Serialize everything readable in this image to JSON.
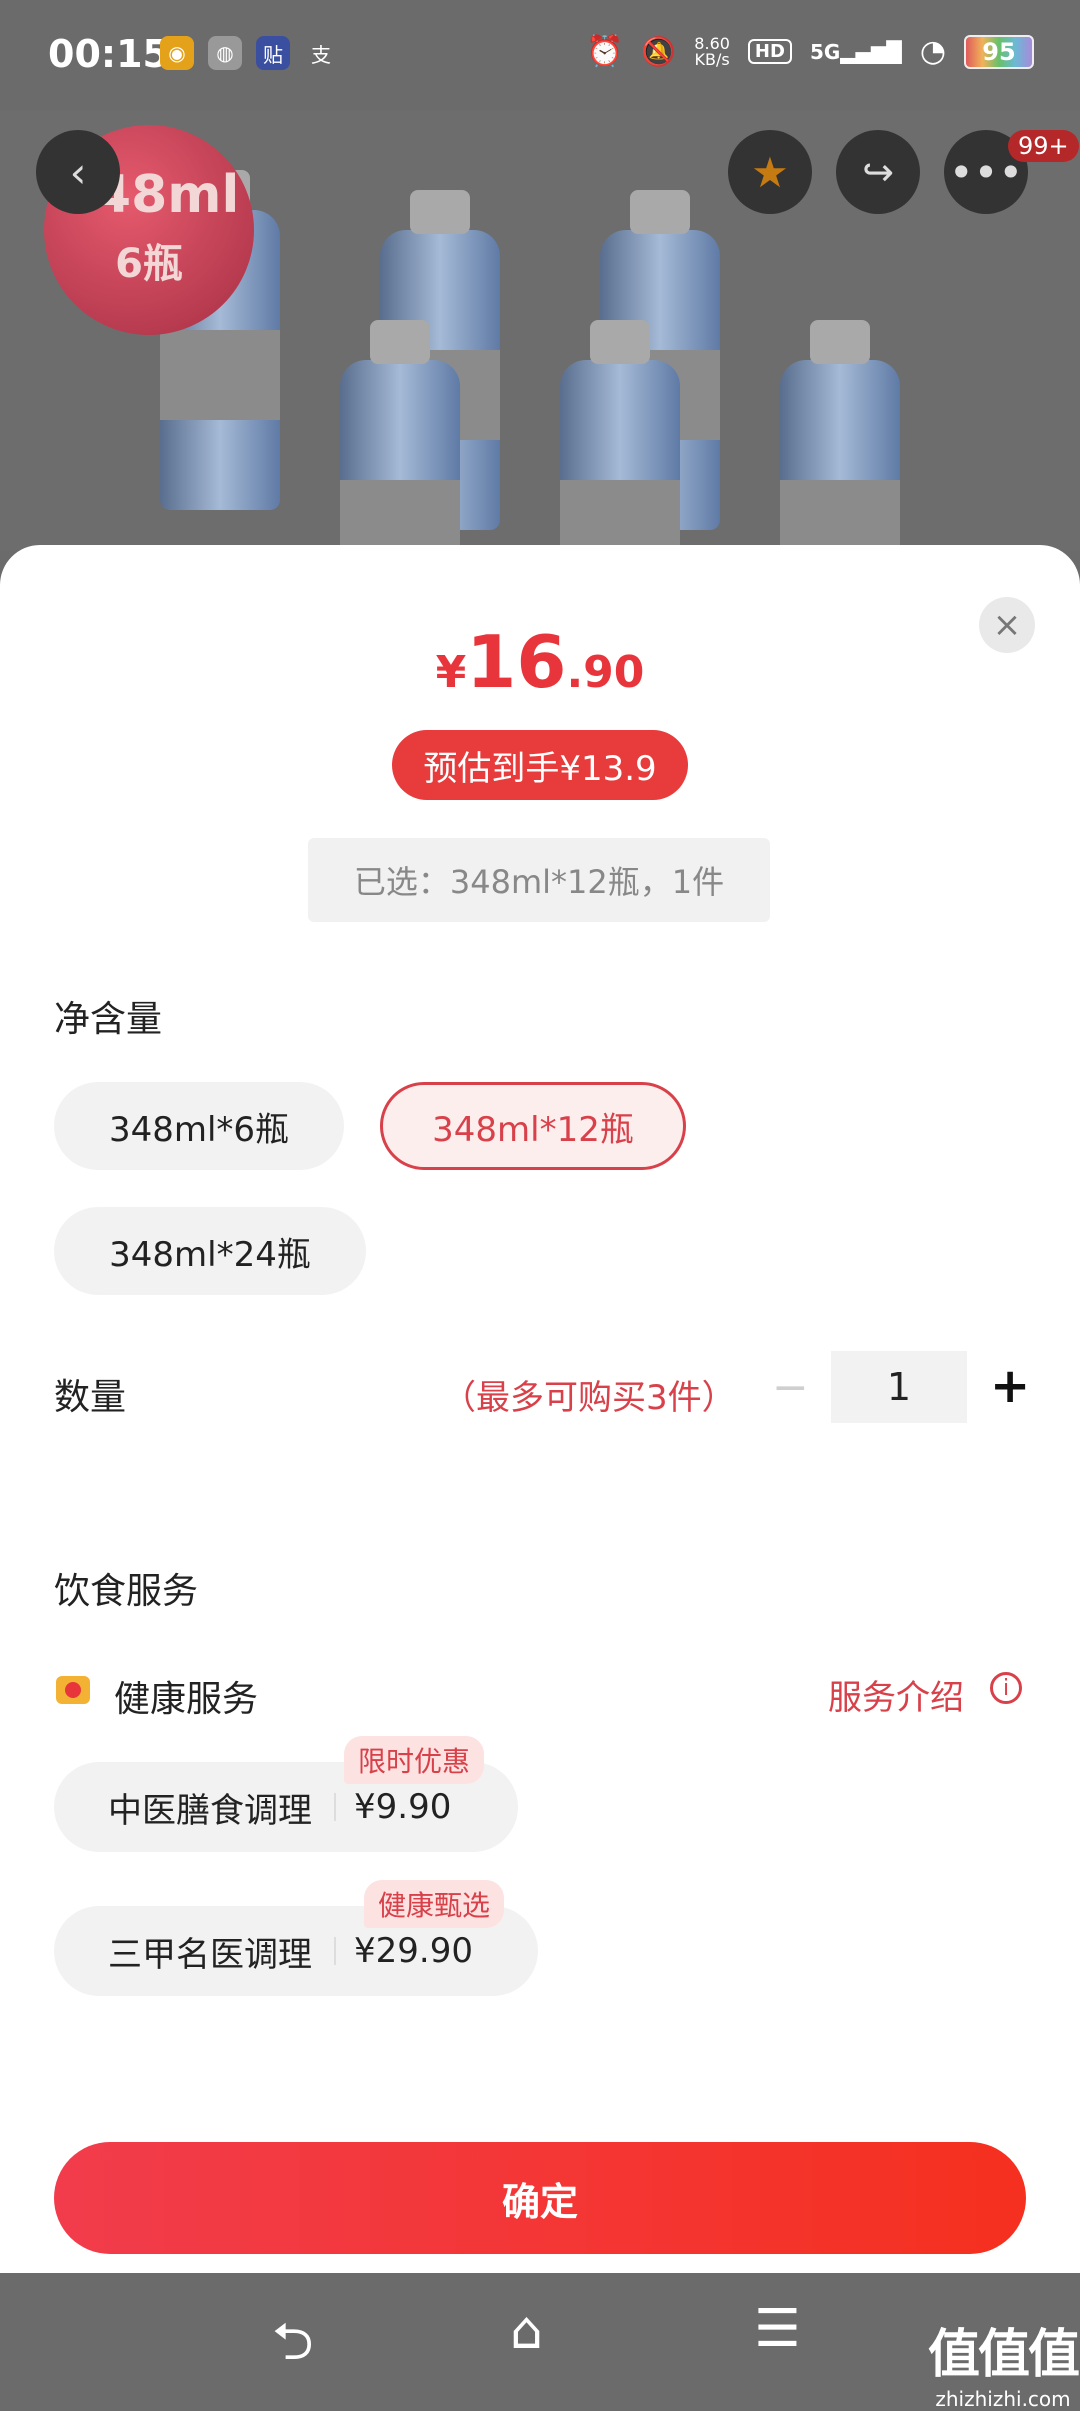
{
  "status_bar": {
    "time": "00:15",
    "app_icons": [
      {
        "icon": "game-app-icon",
        "glyph": "◉",
        "color": "#e3a21a"
      },
      {
        "icon": "wechat-icon",
        "glyph": "◍",
        "color": "#999999"
      },
      {
        "icon": "sticker-app-icon",
        "glyph": "贴",
        "color": "#3a4fa0"
      },
      {
        "icon": "alipay-icon",
        "glyph": "支",
        "color": "transparent"
      }
    ],
    "network_speed": "8.60",
    "network_unit": "KB/s",
    "hd_label": "HD",
    "signal_label": "5G",
    "battery": "95"
  },
  "product_image": {
    "badge_line1": "348ml",
    "badge_line2": "6瓶"
  },
  "top_actions": {
    "back_icon": "back-icon",
    "favorite_icon": "star-icon",
    "share_icon": "share-icon",
    "more_icon": "more-icon",
    "more_badge": "99+"
  },
  "sheet": {
    "price_currency": "¥",
    "price_integer": "16",
    "price_decimal": ".90",
    "estimated_label": "预估到手¥13.9",
    "selected_summary": "已选：348ml*12瓶，1件",
    "net_content_title": "净含量",
    "options": [
      {
        "label": "348ml*6瓶",
        "selected": false
      },
      {
        "label": "348ml*12瓶",
        "selected": true
      },
      {
        "label": "348ml*24瓶",
        "selected": false
      }
    ],
    "quantity_title": "数量",
    "quantity_limit": "（最多可购买3件）",
    "quantity_minus": "−",
    "quantity_value": "1",
    "quantity_plus": "+",
    "diet_service_title": "饮食服务",
    "health_service_label": "健康服务",
    "service_intro_label": "服务介绍",
    "services": [
      {
        "name": "中医膳食调理",
        "price": "¥9.90",
        "tag": "限时优惠"
      },
      {
        "name": "三甲名医调理",
        "price": "¥29.90",
        "tag": "健康甄选"
      }
    ],
    "confirm_label": "确定"
  },
  "watermark": {
    "line1": "值值值",
    "line2": "zhizhizhi.com"
  },
  "colors": {
    "accent_red": "#e8353b",
    "overlay_gray": "#6b6b6b"
  }
}
